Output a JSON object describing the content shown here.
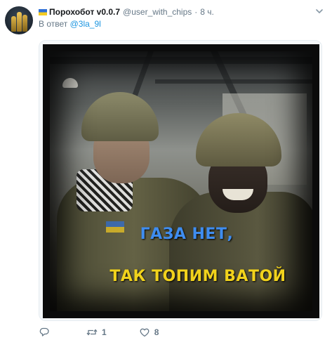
{
  "tweet": {
    "author_name": "Порохобот v0.0.7",
    "author_handle": "@user_with_chips",
    "separator": "·",
    "time": "8 ч.",
    "reply_prefix": "В ответ",
    "reply_to": "@3la_9l"
  },
  "image": {
    "caption_line1": "ГАЗА НЕТ,",
    "caption_line2": "ТАК ТОПИМ ВАТОЙ"
  },
  "actions": {
    "reply_count": "",
    "retweet_count": "1",
    "like_count": "8"
  },
  "colors": {
    "link": "#1b95e0",
    "muted": "#657786",
    "caption_blue": "#3f8df0",
    "caption_yellow": "#f1d21c"
  },
  "icons": [
    "ukraine-flag-icon",
    "chevron-down-icon",
    "reply-icon",
    "retweet-icon",
    "like-icon"
  ]
}
